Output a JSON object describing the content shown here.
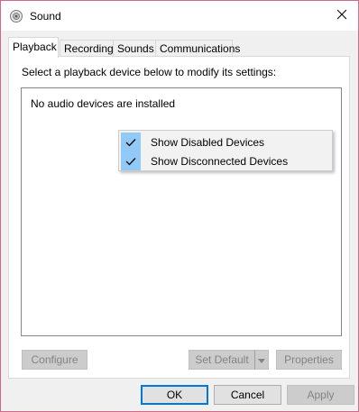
{
  "window": {
    "title": "Sound"
  },
  "tabs": [
    {
      "label": "Playback"
    },
    {
      "label": "Recording"
    },
    {
      "label": "Sounds"
    },
    {
      "label": "Communications"
    }
  ],
  "panel": {
    "instruction": "Select a playback device below to modify its settings:",
    "empty_message": "No audio devices are installed"
  },
  "context_menu": {
    "items": [
      {
        "label": "Show Disabled Devices",
        "checked": true
      },
      {
        "label": "Show Disconnected Devices",
        "checked": true
      }
    ]
  },
  "panel_buttons": {
    "configure": "Configure",
    "set_default": "Set Default",
    "properties": "Properties"
  },
  "dialog_buttons": {
    "ok": "OK",
    "cancel": "Cancel",
    "apply": "Apply"
  },
  "colors": {
    "window_border": "#d16a8a",
    "menu_check_highlight": "#91c9f7",
    "default_button_border": "#0078d7"
  },
  "icons": {
    "title": "speaker-icon",
    "close": "close-icon",
    "check": "checkmark-icon",
    "dropdown": "chevron-down-icon"
  }
}
